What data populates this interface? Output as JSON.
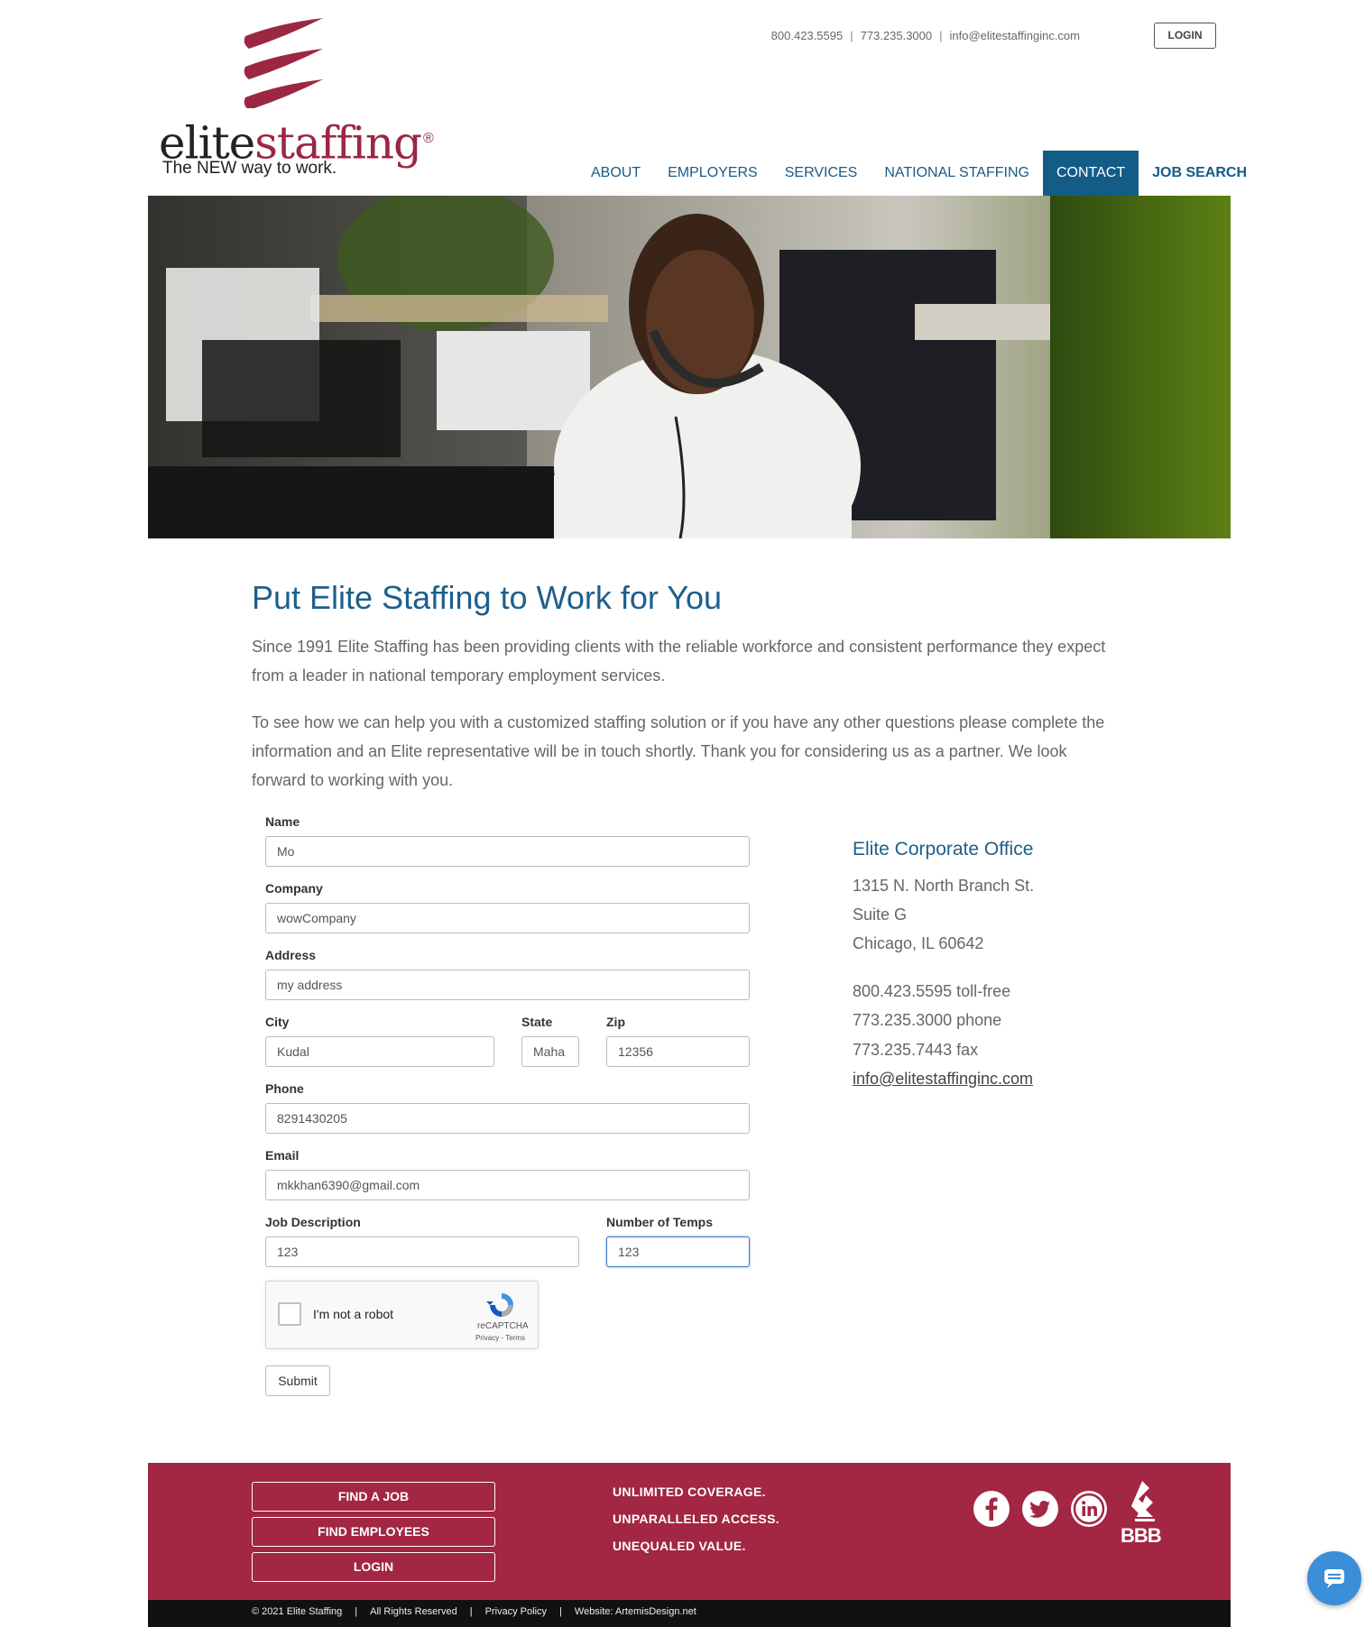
{
  "brand": {
    "name_part1": "elite",
    "name_part2": "staffing",
    "registered": "®",
    "tagline": "The NEW way to work."
  },
  "topbar": {
    "phone_tollfree": "800.423.5595",
    "phone_local": "773.235.3000",
    "email": "info@elitestaffinginc.com",
    "separator": "|",
    "login_label": "LOGIN"
  },
  "nav": {
    "items": [
      {
        "label": "ABOUT"
      },
      {
        "label": "EMPLOYERS"
      },
      {
        "label": "SERVICES"
      },
      {
        "label": "NATIONAL STAFFING"
      },
      {
        "label": "CONTACT"
      },
      {
        "label": "JOB SEARCH"
      }
    ],
    "active": "CONTACT"
  },
  "content": {
    "title": "Put Elite Staffing to Work for You",
    "para1_line1": "Since 1991 Elite Staffing has been providing clients with the reliable workforce and consistent performance they expect",
    "para1_line2": "from a leader in national temporary employment services.",
    "para2_line1": "To see how we can help you with a customized staffing solution or if you have any other questions please complete the",
    "para2_line2": "information and an Elite representative will be in touch shortly. Thank you for considering us as a partner. We look",
    "para2_line3": "forward to working with you."
  },
  "form": {
    "name": {
      "label": "Name",
      "value": "Mo"
    },
    "company": {
      "label": "Company",
      "value": "wowCompany"
    },
    "address": {
      "label": "Address",
      "value": "my address"
    },
    "city": {
      "label": "City",
      "value": "Kudal"
    },
    "state": {
      "label": "State",
      "value": "Maha"
    },
    "zip": {
      "label": "Zip",
      "value": "12356"
    },
    "phone": {
      "label": "Phone",
      "value": "8291430205"
    },
    "email": {
      "label": "Email",
      "value": "mkkhan6390@gmail.com"
    },
    "job_description": {
      "label": "Job Description",
      "value": "123"
    },
    "number_of_temps": {
      "label": "Number of Temps",
      "value": "123"
    },
    "captcha": {
      "label": "I'm not a robot",
      "brand": "reCAPTCHA",
      "links": "Privacy - Terms"
    },
    "submit_label": "Submit"
  },
  "office": {
    "title": "Elite Corporate Office",
    "street": "1315 N. North Branch St.",
    "suite": "Suite G",
    "city": "Chicago, IL 60642",
    "tollfree": "800.423.5595 toll-free",
    "phone": "773.235.3000 phone",
    "fax": "773.235.7443 fax",
    "email": "info@elitestaffinginc.com"
  },
  "footer": {
    "buttons": [
      "FIND A JOB",
      "FIND EMPLOYEES",
      "LOGIN"
    ],
    "slogans": [
      "UNLIMITED COVERAGE.",
      "UNPARALLELED ACCESS.",
      "UNEQUALED VALUE."
    ],
    "social_icons": [
      "facebook-icon",
      "twitter-icon",
      "linkedin-icon"
    ],
    "bbb_label": "BBB",
    "copyright": "© 2021 Elite Staffing",
    "rights": "All Rights Reserved",
    "privacy": "Privacy Policy",
    "website": "Website: ArtemisDesign.net",
    "separator": "|"
  },
  "colors": {
    "brand_red": "#a32642",
    "brand_blue": "#135c88",
    "heading_blue": "#1d5f8c",
    "logo_maroon": "#9b2743"
  }
}
